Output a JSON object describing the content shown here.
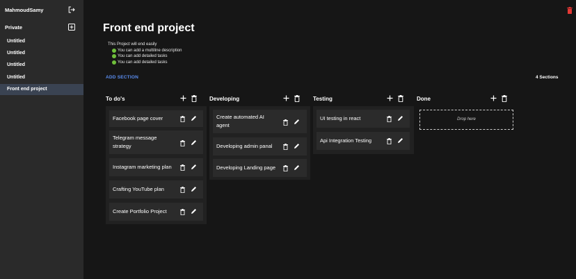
{
  "sidebar": {
    "user": "MahmoudSamy",
    "section_label": "Private",
    "pages": [
      "Untitled",
      "Untitled",
      "Untitled",
      "Untitled",
      "Front end project"
    ]
  },
  "project": {
    "title": "Front end project",
    "description": {
      "first_line": "This Project will end easily",
      "items": [
        "You can add a multiline description",
        "You can add detailed tasks",
        "You can add detailed tasks"
      ]
    },
    "add_section_label": "ADD SECTION",
    "sections_count": "4 Sections"
  },
  "columns": [
    {
      "title": "To do's",
      "cards": [
        "Facebook page cover",
        "Telegram message strategy",
        "Instagram marketing plan",
        "Crafting YouTube plan",
        "Create Portfolio Project"
      ]
    },
    {
      "title": "Developing",
      "cards": [
        "Create automated AI agent",
        "Developing admin panal",
        "Developing Landing page"
      ]
    },
    {
      "title": "Testing",
      "cards": [
        "UI testing in react",
        "Api Integration Testing"
      ]
    },
    {
      "title": "Done",
      "cards": [],
      "drop_label": "Drop here"
    }
  ],
  "colors": {
    "accent": "#5a8df0",
    "danger": "#e53935",
    "active": "#3a4352",
    "bullet": "#6fbf3b"
  }
}
